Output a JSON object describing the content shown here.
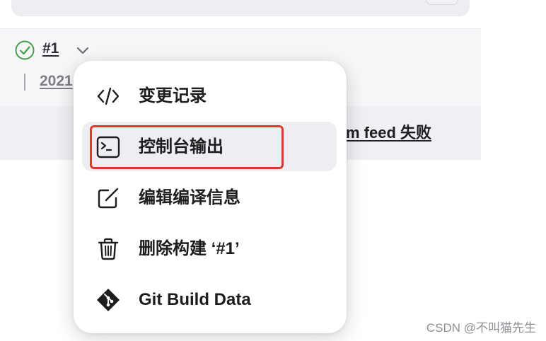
{
  "build": {
    "number": "#1",
    "date": "2021",
    "failure_text": "m feed 失败",
    "status": "success"
  },
  "menu": {
    "items": [
      {
        "label": "变更记录",
        "icon": "code-icon",
        "active": false
      },
      {
        "label": "控制台输出",
        "icon": "terminal-icon",
        "active": true
      },
      {
        "label": "编辑编译信息",
        "icon": "edit-icon",
        "active": false
      },
      {
        "label": "删除构建 ‘#1’",
        "icon": "trash-icon",
        "active": false
      },
      {
        "label": "Git Build Data",
        "icon": "git-icon",
        "active": false
      }
    ]
  },
  "watermark": "CSDN @不叫猫先生",
  "colors": {
    "success": "#43a047",
    "highlight": "#e03a2f",
    "menu_active_bg": "#eeeef2"
  }
}
